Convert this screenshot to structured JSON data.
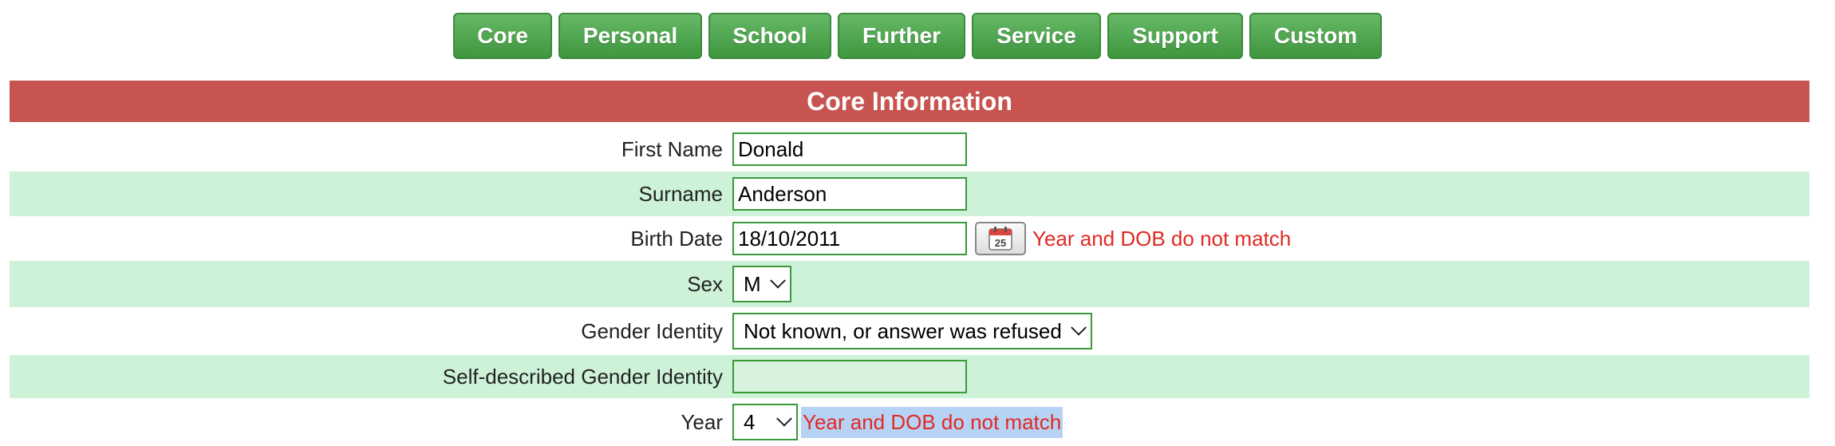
{
  "tabs": [
    {
      "label": "Core"
    },
    {
      "label": "Personal"
    },
    {
      "label": "School"
    },
    {
      "label": "Further"
    },
    {
      "label": "Service"
    },
    {
      "label": "Support"
    },
    {
      "label": "Custom"
    }
  ],
  "section": {
    "title": "Core Information"
  },
  "fields": {
    "first_name": {
      "label": "First Name",
      "value": "Donald"
    },
    "surname": {
      "label": "Surname",
      "value": "Anderson"
    },
    "birth_date": {
      "label": "Birth Date",
      "value": "18/10/2011",
      "calendar_day": "25",
      "error": "Year and DOB do not match"
    },
    "sex": {
      "label": "Sex",
      "value": "M"
    },
    "gender_identity": {
      "label": "Gender Identity",
      "value": "Not known, or answer was refused"
    },
    "self_described": {
      "label": "Self-described Gender Identity",
      "value": ""
    },
    "year": {
      "label": "Year",
      "value": "4",
      "error": "Year and DOB do not match"
    }
  },
  "colors": {
    "tab_green": "#4ea64e",
    "header_red": "#c75450",
    "row_alt": "#cdf2d7",
    "error_red": "#e02a22",
    "highlight_blue": "#b6d2f5"
  },
  "icons": {
    "calendar": "calendar-icon",
    "dropdown": "chevron-down-icon"
  }
}
